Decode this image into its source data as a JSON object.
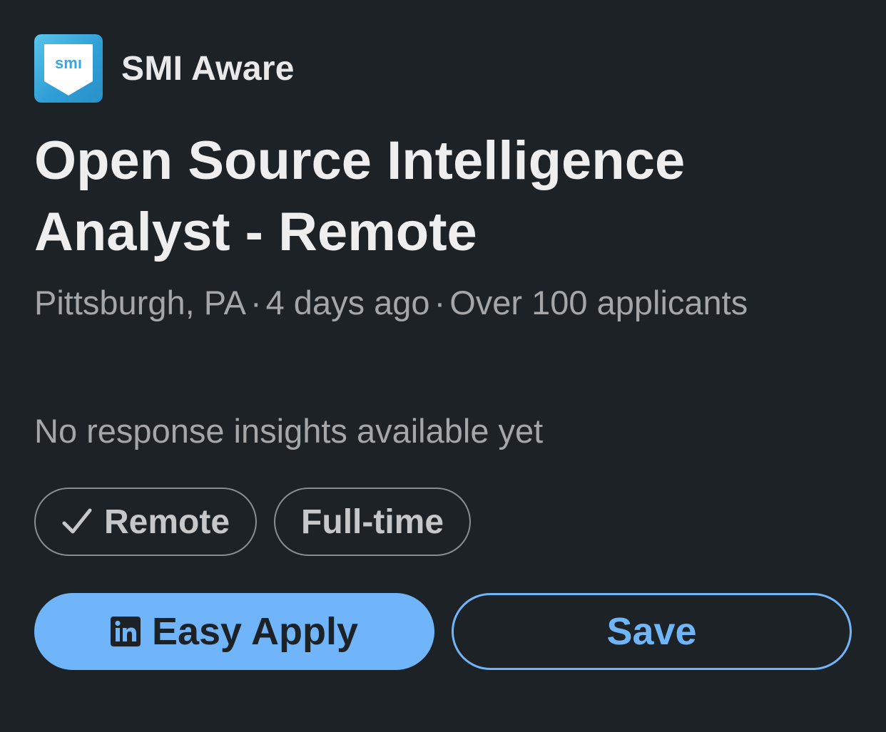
{
  "company": {
    "name": "SMI Aware",
    "logo_text": "smı"
  },
  "job": {
    "title": "Open Source Intelligence Analyst - Remote",
    "location": "Pittsburgh, PA",
    "posted": "4 days ago",
    "applicants": "Over 100 applicants",
    "separator": "·",
    "insights": "No response insights available yet"
  },
  "chips": [
    {
      "label": "Remote",
      "icon": "checkmark-icon"
    },
    {
      "label": "Full-time"
    }
  ],
  "actions": {
    "apply_label": "Easy Apply",
    "apply_icon": "linkedin-icon",
    "save_label": "Save"
  },
  "colors": {
    "background": "#1d2226",
    "accent": "#70b5f9",
    "muted_text": "#a4a6a8"
  }
}
